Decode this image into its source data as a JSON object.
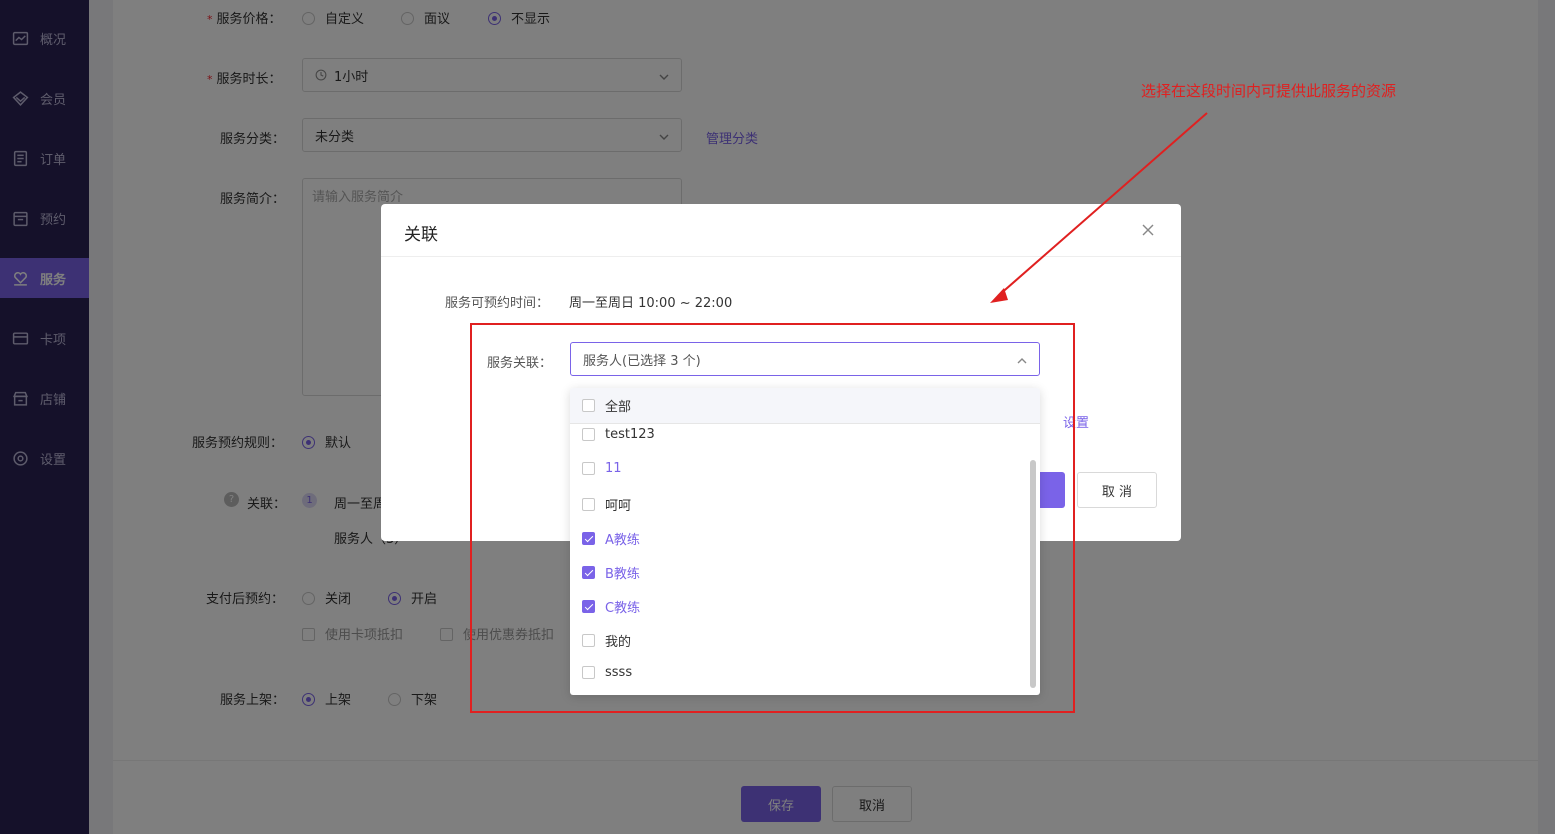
{
  "sidebar": {
    "items": [
      {
        "label": "概况",
        "icon": "chart-icon"
      },
      {
        "label": "会员",
        "icon": "diamond-icon"
      },
      {
        "label": "订单",
        "icon": "list-icon"
      },
      {
        "label": "预约",
        "icon": "calendar-icon"
      },
      {
        "label": "服务",
        "icon": "heart-hand-icon",
        "active": true
      },
      {
        "label": "卡项",
        "icon": "card-icon"
      },
      {
        "label": "店铺",
        "icon": "store-icon"
      },
      {
        "label": "设置",
        "icon": "gear-icon"
      }
    ]
  },
  "form": {
    "price": {
      "label": "服务价格：",
      "options": [
        "自定义",
        "面议",
        "不显示"
      ],
      "selected": "不显示"
    },
    "duration": {
      "label": "服务时长：",
      "value": "1小时"
    },
    "category": {
      "label": "服务分类：",
      "value": "未分类",
      "link": "管理分类"
    },
    "intro": {
      "label": "服务简介：",
      "placeholder": "请输入服务简介"
    },
    "rule": {
      "label": "服务预约规则：",
      "option": "默认"
    },
    "relation": {
      "label": "关联：",
      "index": "1",
      "text": "周一至周",
      "sub": "服务人（3）"
    },
    "pay_booking": {
      "label": "支付后预约：",
      "options": [
        "关闭",
        "开启"
      ],
      "selected": "开启",
      "checks": [
        "使用卡项抵扣",
        "使用优惠券抵扣"
      ]
    },
    "shelf": {
      "label": "服务上架：",
      "options": [
        "上架",
        "下架"
      ],
      "selected": "上架"
    }
  },
  "footer": {
    "save": "保存",
    "cancel": "取消"
  },
  "modal": {
    "title": "关联",
    "time_label": "服务可预约时间：",
    "time_value": "周一至周日 10:00 ~ 22:00",
    "relation_label": "服务关联：",
    "select_value": "服务人(已选择 3 个)",
    "settings_link": "设置",
    "cancel": "取 消"
  },
  "dropdown": {
    "all": "全部",
    "items": [
      {
        "label": "test123",
        "checked": false
      },
      {
        "label": "11",
        "checked": false
      },
      {
        "label": "呵呵",
        "checked": false
      },
      {
        "label": "A教练",
        "checked": true
      },
      {
        "label": "B教练",
        "checked": true
      },
      {
        "label": "C教练",
        "checked": true
      },
      {
        "label": "我的",
        "checked": false
      },
      {
        "label": "ssss",
        "checked": false
      }
    ]
  },
  "annotation": {
    "text": "选择在这段时间内可提供此服务的资源",
    "color": "#e02020"
  },
  "colors": {
    "accent": "#7a63e8",
    "sidebar": "#2a2354"
  }
}
